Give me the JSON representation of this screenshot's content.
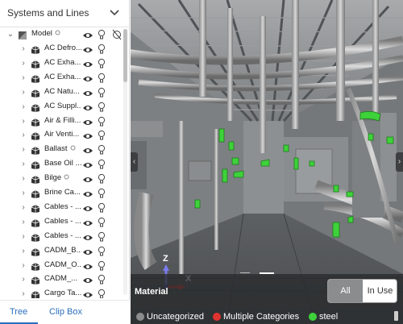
{
  "panel": {
    "title": "Systems and Lines",
    "collapse_icon": "chevron-down-icon"
  },
  "tree": {
    "root": {
      "label": "Model",
      "icon": "model-icon",
      "expanded": true
    },
    "items": [
      {
        "label": "AC Defro...",
        "tagged": false
      },
      {
        "label": "AC Exha...",
        "tagged": false
      },
      {
        "label": "AC Exha...",
        "tagged": false
      },
      {
        "label": "AC Natu...",
        "tagged": false
      },
      {
        "label": "AC Suppl...",
        "tagged": false
      },
      {
        "label": "Air & Filli...",
        "tagged": false
      },
      {
        "label": "Air Venti...",
        "tagged": false
      },
      {
        "label": "Ballast",
        "tagged": true
      },
      {
        "label": "Base Oil ...",
        "tagged": false
      },
      {
        "label": "Bilge",
        "tagged": true
      },
      {
        "label": "Brine Ca...",
        "tagged": false
      },
      {
        "label": "Cables - ...",
        "tagged": false
      },
      {
        "label": "Cables - ...",
        "tagged": false
      },
      {
        "label": "Cables - ...",
        "tagged": false
      },
      {
        "label": "CADM_B...",
        "tagged": false
      },
      {
        "label": "CADM_O...",
        "tagged": false
      },
      {
        "label": "CADM_...",
        "tagged": false
      },
      {
        "label": "Cargo Ta...",
        "tagged": false
      }
    ]
  },
  "tabs": {
    "tree": "Tree",
    "clip_box": "Clip Box",
    "active": "tree"
  },
  "viewport": {
    "axis_z": "Z",
    "axis_x": "X",
    "left_arrow": "‹",
    "right_arrow": "›"
  },
  "material": {
    "title": "Material",
    "filter_all": "All",
    "filter_in_use": "In Use",
    "active_filter": "All",
    "legend": [
      {
        "label": "Uncategorized",
        "color": "#8c8c8c"
      },
      {
        "label": "Multiple Categories",
        "color": "#e0332f"
      },
      {
        "label": "steel",
        "color": "#3ed23a"
      }
    ]
  },
  "colors": {
    "accent": "#2a6ebc",
    "highlight_green": "#3ed23a"
  }
}
